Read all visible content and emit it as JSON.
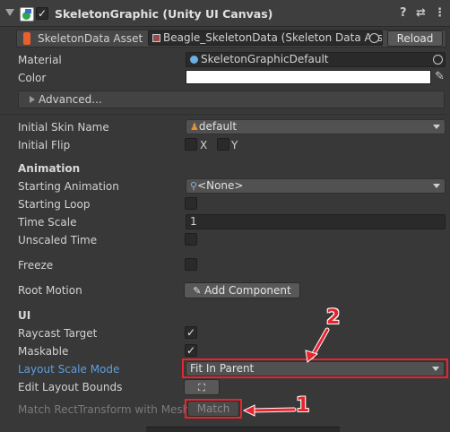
{
  "header": {
    "title": "SkeletonGraphic (Unity UI Canvas)",
    "enabled_checkbox": "✓"
  },
  "skeleton_data": {
    "label": "SkeletonData Asset",
    "value": "Beagle_SkeletonData (Skeleton Data Ass",
    "reload_label": "Reload"
  },
  "material": {
    "label": "Material",
    "value": "SkeletonGraphicDefault"
  },
  "color": {
    "label": "Color",
    "value": "#ffffff"
  },
  "advanced": {
    "label": "Advanced..."
  },
  "initial_skin": {
    "label": "Initial Skin Name",
    "value": "default"
  },
  "initial_flip": {
    "label": "Initial Flip",
    "x_label": "X",
    "y_label": "Y"
  },
  "animation_section": {
    "title": "Animation",
    "starting_animation_label": "Starting Animation",
    "starting_animation_value": "<None>",
    "starting_loop_label": "Starting Loop",
    "time_scale_label": "Time Scale",
    "time_scale_value": "1",
    "unscaled_time_label": "Unscaled Time",
    "freeze_label": "Freeze",
    "root_motion_label": "Root Motion",
    "add_component_label": "Add Component"
  },
  "ui_section": {
    "title": "UI",
    "raycast_target_label": "Raycast Target",
    "raycast_target_check": "✓",
    "maskable_label": "Maskable",
    "maskable_check": "✓",
    "layout_scale_mode_label": "Layout Scale Mode",
    "layout_scale_mode_value": "Fit In Parent",
    "edit_layout_bounds_label": "Edit Layout Bounds",
    "match_label": "Match RectTransform with Mesh",
    "match_button": "Match"
  },
  "callouts": {
    "one": "1",
    "two": "2"
  },
  "colors": {
    "highlight_red": "#e8242c",
    "label_blue": "#5e9ee0"
  },
  "icons": [
    "foldout-arrow-icon",
    "component-icon",
    "help-icon",
    "preset-icon",
    "menu-icon",
    "spine-asset-icon",
    "material-icon",
    "target-icon",
    "eyedropper-icon",
    "skin-icon",
    "animation-icon",
    "add-component-icon",
    "edit-bounds-icon"
  ]
}
